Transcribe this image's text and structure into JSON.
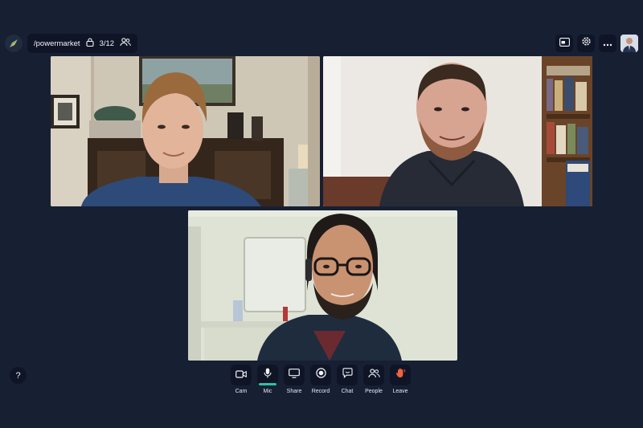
{
  "room": {
    "name": "/powermarket",
    "participant_count": "3/12"
  },
  "icons": {
    "logo": "compass-logo-icon",
    "lock": "lock-icon",
    "people": "people-icon",
    "pip": "picture-in-picture-icon",
    "settings": "gear-icon",
    "more": "more-dots-icon"
  },
  "controls": {
    "cam_label": "Cam",
    "mic_label": "Mic",
    "share_label": "Share",
    "record_label": "Record",
    "chat_label": "Chat",
    "people_label": "People",
    "leave_label": "Leave"
  },
  "help": {
    "label": "?"
  },
  "colors": {
    "background": "#171f33",
    "button_bg": "#0f1526",
    "mic_active": "#2fc29b",
    "leave_hand": "#f0643c"
  }
}
